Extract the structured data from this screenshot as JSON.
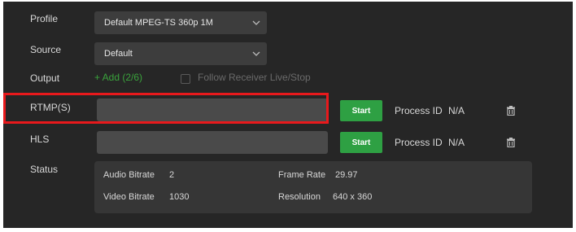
{
  "labels": {
    "profile": "Profile",
    "source": "Source",
    "output": "Output",
    "rtmp": "RTMP(S)",
    "hls": "HLS",
    "status": "Status"
  },
  "profile_select": {
    "value": "Default MPEG-TS 360p 1M"
  },
  "source_select": {
    "value": "Default"
  },
  "output": {
    "add_label": "+ Add (2/6)",
    "follow_label": "Follow Receiver Live/Stop",
    "follow_checked": false
  },
  "rtmp": {
    "url_value": "",
    "start_label": "Start",
    "process_id_label": "Process ID",
    "process_id_value": "N/A"
  },
  "hls": {
    "url_value": "",
    "start_label": "Start",
    "process_id_label": "Process ID",
    "process_id_value": "N/A"
  },
  "status": {
    "audio_bitrate_label": "Audio Bitrate",
    "audio_bitrate_value": "2",
    "frame_rate_label": "Frame Rate",
    "frame_rate_value": "29.97",
    "video_bitrate_label": "Video Bitrate",
    "video_bitrate_value": "1030",
    "resolution_label": "Resolution",
    "resolution_value": "640 x 360"
  },
  "colors": {
    "background": "#262626",
    "accent_green": "#2ea043",
    "add_green": "#3aa33c",
    "highlight_red": "#e8191c"
  },
  "icons": {
    "chevron": "chevron-down-icon",
    "trash": "trash-icon",
    "checkbox": "checkbox-icon"
  }
}
